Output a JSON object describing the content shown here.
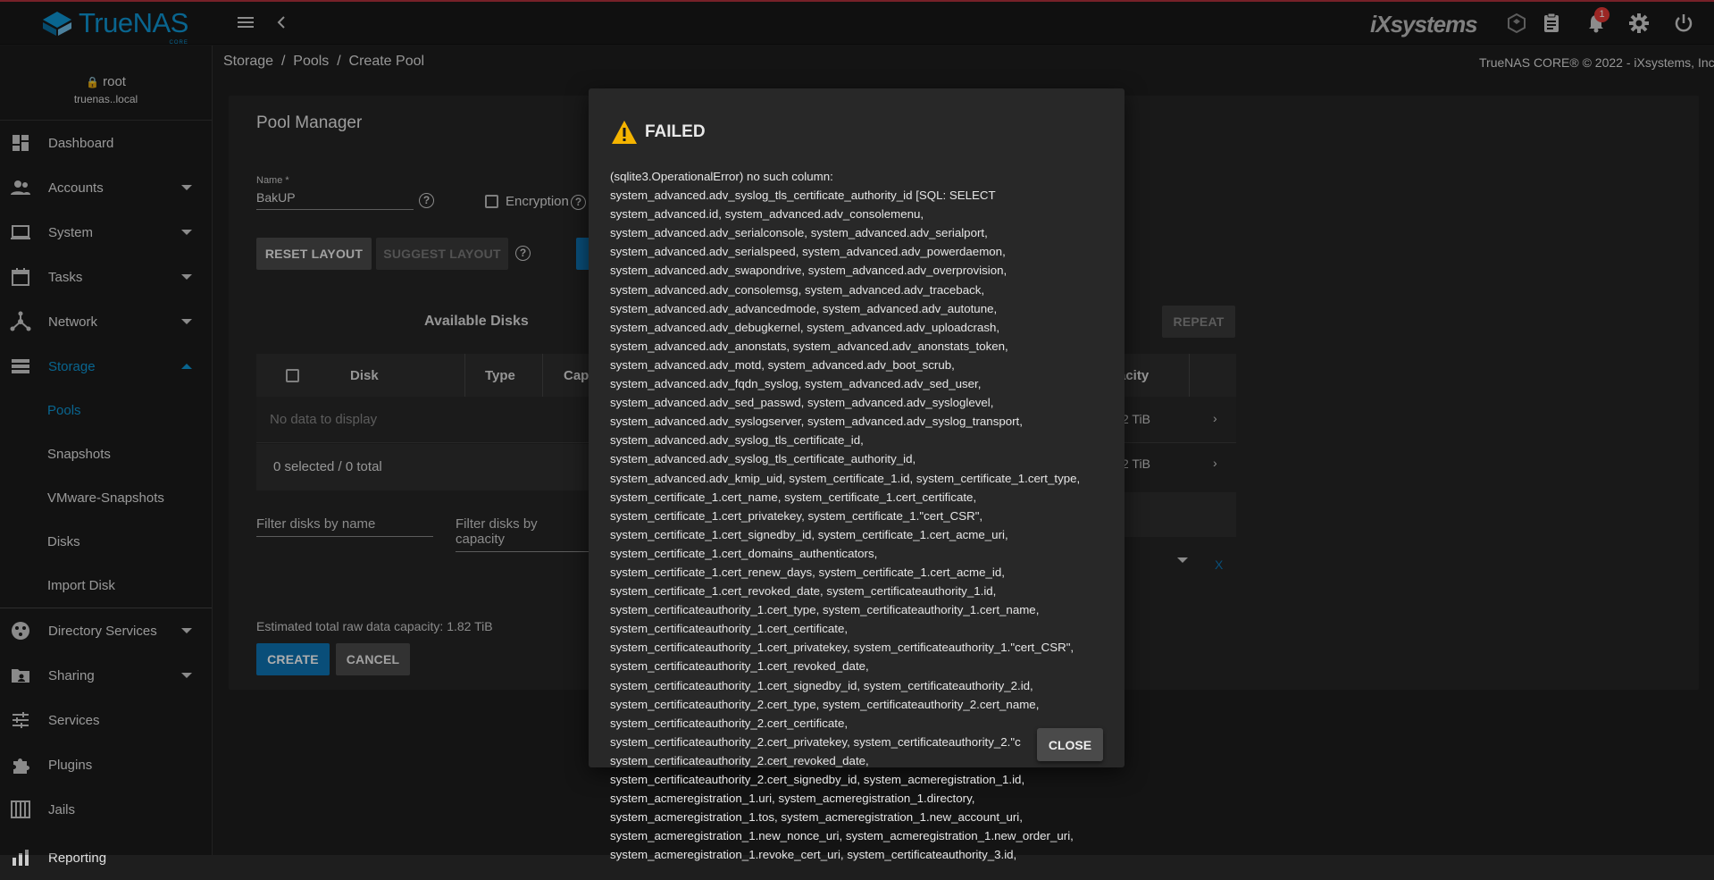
{
  "topbar": {
    "logo_text": "TrueNAS",
    "logo_sub": "CORE",
    "vendor_logo": "iXsystems",
    "notification_count": "1",
    "icons": [
      "menu-icon",
      "back-icon",
      "truecommand-icon",
      "task-manager-icon",
      "bell-icon",
      "gear-icon",
      "power-icon"
    ]
  },
  "sidebar": {
    "user": "root",
    "host": "truenas..local",
    "items": [
      {
        "label": "Dashboard",
        "icon": "dashboard-icon"
      },
      {
        "label": "Accounts",
        "icon": "accounts-icon"
      },
      {
        "label": "System",
        "icon": "system-icon"
      },
      {
        "label": "Tasks",
        "icon": "tasks-icon"
      },
      {
        "label": "Network",
        "icon": "network-icon"
      },
      {
        "label": "Storage",
        "icon": "storage-icon"
      },
      {
        "label": "Directory Services",
        "icon": "directory-icon"
      },
      {
        "label": "Sharing",
        "icon": "sharing-icon"
      },
      {
        "label": "Services",
        "icon": "services-icon"
      },
      {
        "label": "Plugins",
        "icon": "plugins-icon"
      },
      {
        "label": "Jails",
        "icon": "jails-icon"
      },
      {
        "label": "Reporting",
        "icon": "reporting-icon"
      }
    ],
    "storage_sub": [
      "Pools",
      "Snapshots",
      "VMware-Snapshots",
      "Disks",
      "Import Disk"
    ]
  },
  "breadcrumb": {
    "items": [
      "Storage",
      "Pools",
      "Create Pool"
    ],
    "sep": "/"
  },
  "copyright": "TrueNAS CORE® © 2022 - iXsystems, Inc.",
  "pool_manager": {
    "title": "Pool Manager",
    "name_label": "Name *",
    "name_value": "BakUP",
    "encryption_label": "Encryption",
    "reset_layout": "RESET LAYOUT",
    "suggest_layout": "SUGGEST LAYOUT",
    "repeat": "REPEAT",
    "available_disks": "Available Disks",
    "columns": [
      "Disk",
      "Type",
      "Capa",
      "acity"
    ],
    "no_data": "No data to display",
    "selected_count": "0 selected / 0 total",
    "filter_name": "Filter disks by name",
    "filter_capacity": "Filter disks by capacity",
    "capacity_rows": [
      "2 TiB",
      "2 TiB"
    ],
    "x_mark": "X",
    "estimate": "Estimated total raw data capacity: 1.82 TiB",
    "create": "CREATE",
    "cancel": "CANCEL"
  },
  "dialog": {
    "title": "FAILED",
    "close": "CLOSE",
    "message": "(sqlite3.OperationalError) no such column:\nsystem_advanced.adv_syslog_tls_certificate_authority_id [SQL: SELECT\nsystem_advanced.id, system_advanced.adv_consolemenu,\nsystem_advanced.adv_serialconsole, system_advanced.adv_serialport,\nsystem_advanced.adv_serialspeed, system_advanced.adv_powerdaemon,\nsystem_advanced.adv_swapondrive, system_advanced.adv_overprovision,\nsystem_advanced.adv_consolemsg, system_advanced.adv_traceback,\nsystem_advanced.adv_advancedmode, system_advanced.adv_autotune,\nsystem_advanced.adv_debugkernel, system_advanced.adv_uploadcrash,\nsystem_advanced.adv_anonstats, system_advanced.adv_anonstats_token,\nsystem_advanced.adv_motd, system_advanced.adv_boot_scrub,\nsystem_advanced.adv_fqdn_syslog, system_advanced.adv_sed_user,\nsystem_advanced.adv_sed_passwd, system_advanced.adv_sysloglevel,\nsystem_advanced.adv_syslogserver, system_advanced.adv_syslog_transport,\nsystem_advanced.adv_syslog_tls_certificate_id,\nsystem_advanced.adv_syslog_tls_certificate_authority_id,\nsystem_advanced.adv_kmip_uid, system_certificate_1.id, system_certificate_1.cert_type,\nsystem_certificate_1.cert_name, system_certificate_1.cert_certificate,\nsystem_certificate_1.cert_privatekey, system_certificate_1.\"cert_CSR\",\nsystem_certificate_1.cert_signedby_id, system_certificate_1.cert_acme_uri,\nsystem_certificate_1.cert_domains_authenticators,\nsystem_certificate_1.cert_renew_days, system_certificate_1.cert_acme_id,\nsystem_certificate_1.cert_revoked_date, system_certificateauthority_1.id,\nsystem_certificateauthority_1.cert_type, system_certificateauthority_1.cert_name,\nsystem_certificateauthority_1.cert_certificate,\nsystem_certificateauthority_1.cert_privatekey, system_certificateauthority_1.\"cert_CSR\",\nsystem_certificateauthority_1.cert_revoked_date,\nsystem_certificateauthority_1.cert_signedby_id, system_certificateauthority_2.id,\nsystem_certificateauthority_2.cert_type, system_certificateauthority_2.cert_name,\nsystem_certificateauthority_2.cert_certificate,\nsystem_certificateauthority_2.cert_privatekey, system_certificateauthority_2.\"c\nsystem_certificateauthority_2.cert_revoked_date,\nsystem_certificateauthority_2.cert_signedby_id, system_acmeregistration_1.id,\nsystem_acmeregistration_1.uri, system_acmeregistration_1.directory,\nsystem_acmeregistration_1.tos, system_acmeregistration_1.new_account_uri,\nsystem_acmeregistration_1.new_nonce_uri, system_acmeregistration_1.new_order_uri,\nsystem_acmeregistration_1.revoke_cert_uri, system_certificateauthority_3.id,"
  },
  "colors": {
    "accent": "#0e95d3",
    "background": "#1e1e1e",
    "card": "#252525",
    "warning": "#f5b400"
  }
}
